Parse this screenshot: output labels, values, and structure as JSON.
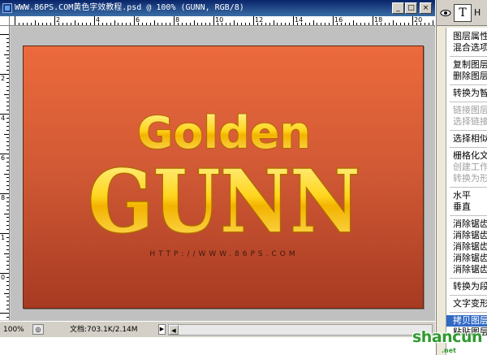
{
  "window": {
    "title": "WWW.86PS.COM黄色字效教程.psd @ 100% (GUNN, RGB/8)",
    "min_label": "_",
    "max_label": "□",
    "close_label": "×"
  },
  "rulers": {
    "top_labels": [
      "2",
      "4",
      "6",
      "8",
      "10",
      "12",
      "14",
      "16",
      "18",
      "20"
    ],
    "left_labels": [
      "2",
      "4",
      "6",
      "8",
      "1",
      "0"
    ]
  },
  "artwork": {
    "line1": "Golden",
    "line2": "GUNN",
    "url": "HTTP://WWW.86PS.COM"
  },
  "status": {
    "zoom": "100%",
    "doc_info": "文档:703.1K/2.14M",
    "arrow": "▶",
    "left_arrow": "◀",
    "right_arrow": "▶"
  },
  "panel": {
    "layer_type_glyph": "T",
    "layer_name": "H"
  },
  "context_menu": {
    "items": [
      {
        "label": "图层属性",
        "disabled": false
      },
      {
        "label": "混合选项",
        "disabled": false
      },
      {
        "sep": true
      },
      {
        "label": "复制图层",
        "disabled": false
      },
      {
        "label": "删除图层",
        "disabled": false
      },
      {
        "sep": true
      },
      {
        "label": "转换为智能对象",
        "disabled": false
      },
      {
        "sep": true
      },
      {
        "label": "链接图层",
        "disabled": true
      },
      {
        "label": "选择链接图层",
        "disabled": true
      },
      {
        "sep": true
      },
      {
        "label": "选择相似图层",
        "disabled": false
      },
      {
        "sep": true
      },
      {
        "label": "栅格化文字",
        "disabled": false
      },
      {
        "label": "创建工作路径",
        "disabled": true
      },
      {
        "label": "转换为形状",
        "disabled": true
      },
      {
        "sep": true
      },
      {
        "label": "水平",
        "disabled": false
      },
      {
        "label": "垂直",
        "disabled": false
      },
      {
        "sep": true
      },
      {
        "label": "消除锯齿无",
        "disabled": false
      },
      {
        "label": "消除锯齿锐利",
        "disabled": false
      },
      {
        "label": "消除锯齿犀利",
        "disabled": false
      },
      {
        "label": "消除锯齿浑厚",
        "disabled": false
      },
      {
        "label": "消除锯齿平滑",
        "disabled": false
      },
      {
        "sep": true
      },
      {
        "label": "转换为段落文本",
        "disabled": false
      },
      {
        "sep": true
      },
      {
        "label": "文字变形...",
        "disabled": false
      },
      {
        "sep": true
      },
      {
        "label": "拷贝图层样式",
        "disabled": false,
        "highlight": true
      },
      {
        "label": "粘贴图层样式",
        "disabled": false
      }
    ]
  },
  "watermark": {
    "text": "shancun",
    "sub": ".net"
  },
  "colors": {
    "canvas_top": "#ec6a3c",
    "canvas_bottom": "#a73a22",
    "gold_light": "#fff27a",
    "gold_dark": "#e0a000",
    "title_bar": "#0a246a",
    "menu_highlight": "#316ac5"
  }
}
